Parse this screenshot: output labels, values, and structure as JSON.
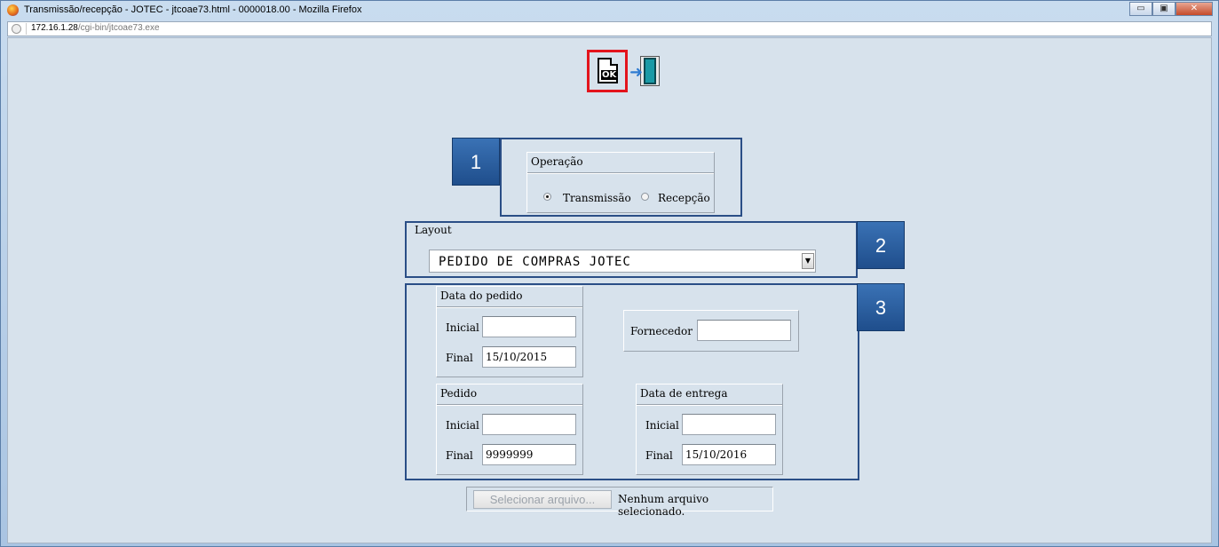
{
  "window": {
    "title": "Transmissão/recepção - JOTEC - jtcoae73.html - 0000018.00 - Mozilla Firefox",
    "controls": {
      "minimize": "▭",
      "maximize": "▣",
      "close": "✕"
    }
  },
  "address_bar": {
    "host": "172.16.1.28",
    "path": "/cgi-bin/jtcoae73.exe"
  },
  "toolbar": {
    "ok_label": "OK"
  },
  "steps": [
    "1",
    "2",
    "3"
  ],
  "operacao": {
    "title": "Operação",
    "options": [
      {
        "label": "Transmissão",
        "selected": true
      },
      {
        "label": "Recepção",
        "selected": false
      }
    ]
  },
  "layout": {
    "title": "Layout",
    "selected": "PEDIDO DE COMPRAS JOTEC"
  },
  "data_pedido": {
    "title": "Data do pedido",
    "inicial_label": "Inicial",
    "inicial_value": "",
    "final_label": "Final",
    "final_value": "15/10/2015"
  },
  "fornecedor": {
    "label": "Fornecedor",
    "value": ""
  },
  "pedido": {
    "title": "Pedido",
    "inicial_label": "Inicial",
    "inicial_value": "",
    "final_label": "Final",
    "final_value": "9999999"
  },
  "data_entrega": {
    "title": "Data de entrega",
    "inicial_label": "Inicial",
    "inicial_value": "",
    "final_label": "Final",
    "final_value": "15/10/2016"
  },
  "file": {
    "button_label": "Selecionar arquivo...",
    "status": "Nenhum arquivo selecionado."
  },
  "colors": {
    "highlight": "#e3141c",
    "badge": "#2a5c9e",
    "background": "#d7e2ec"
  }
}
